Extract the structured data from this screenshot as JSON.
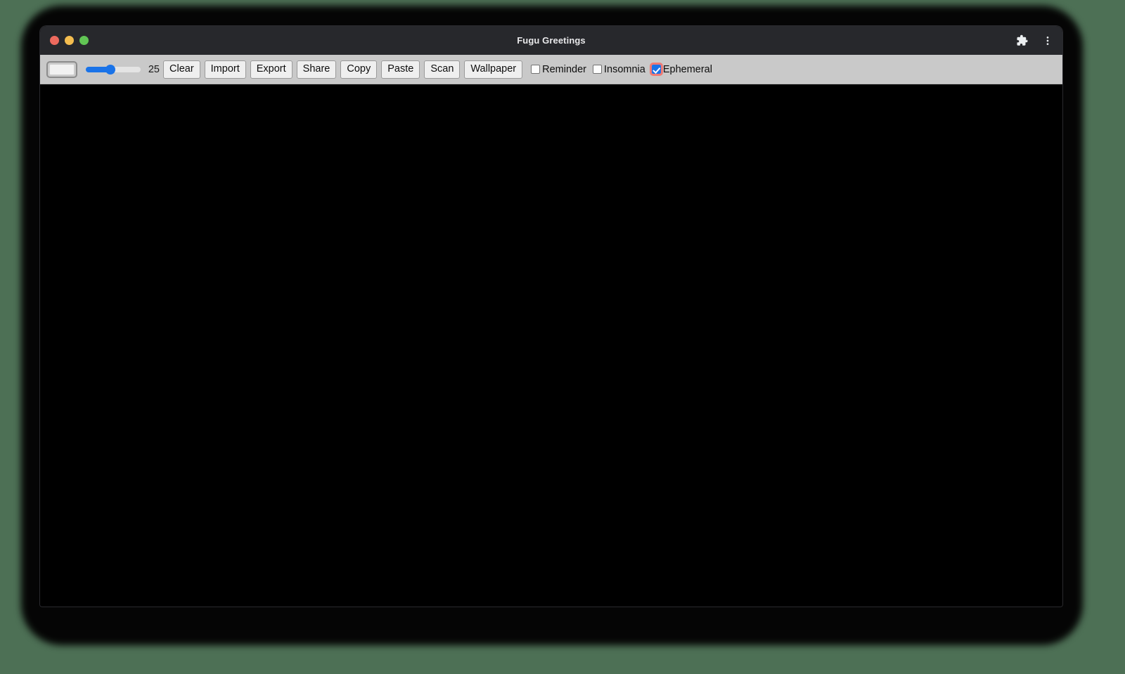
{
  "window": {
    "title": "Fugu Greetings",
    "traffic_lights": [
      {
        "name": "close",
        "color": "#ed6a5e"
      },
      {
        "name": "minimize",
        "color": "#f4bd4f"
      },
      {
        "name": "maximize",
        "color": "#61c554"
      }
    ],
    "actions": [
      {
        "name": "extensions-icon",
        "label": "Extensions"
      },
      {
        "name": "more-menu-icon",
        "label": "More"
      }
    ]
  },
  "toolbar": {
    "color_picker": {
      "label": "Pen color",
      "value": "#f2f2f2"
    },
    "slider": {
      "label": "Line width",
      "value": "25",
      "min": "1",
      "max": "50"
    },
    "buttons": [
      {
        "name": "clear-button",
        "label": "Clear"
      },
      {
        "name": "import-button",
        "label": "Import"
      },
      {
        "name": "export-button",
        "label": "Export"
      },
      {
        "name": "share-button",
        "label": "Share"
      },
      {
        "name": "copy-button",
        "label": "Copy"
      },
      {
        "name": "paste-button",
        "label": "Paste"
      },
      {
        "name": "scan-button",
        "label": "Scan"
      },
      {
        "name": "wallpaper-button",
        "label": "Wallpaper"
      }
    ],
    "checkboxes": [
      {
        "name": "reminder-checkbox",
        "label": "Reminder",
        "checked": false,
        "focused": false
      },
      {
        "name": "insomnia-checkbox",
        "label": "Insomnia",
        "checked": false,
        "focused": false
      },
      {
        "name": "ephemeral-checkbox",
        "label": "Ephemeral",
        "checked": true,
        "focused": true
      }
    ]
  },
  "canvas": {
    "label": "Drawing canvas",
    "background": "#000000"
  },
  "colors": {
    "accent": "#1a73e8",
    "focus_ring": "#f07a72",
    "toolbar_bg": "#c9c9c9",
    "titlebar_bg": "#27282c",
    "desktop_bg": "#4d7055"
  }
}
